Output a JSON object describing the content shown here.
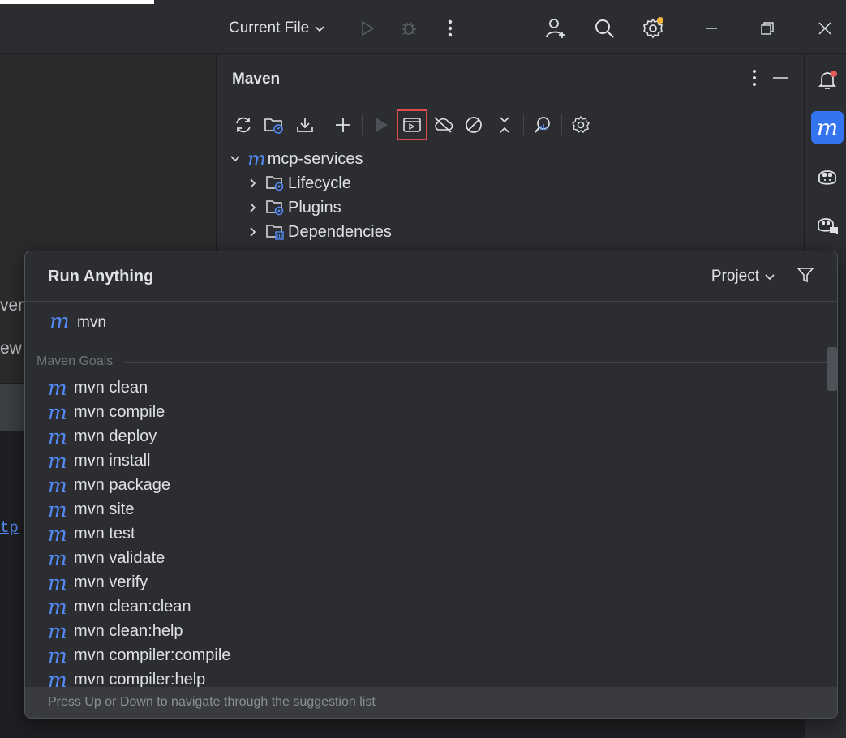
{
  "toolbar": {
    "run_config": "Current File",
    "icons": [
      "run-icon",
      "debug-icon",
      "more-vertical-icon",
      "add-user-icon",
      "search-icon",
      "settings-icon",
      "minimize-icon",
      "restore-icon",
      "close-icon"
    ],
    "settings_badge_color": "#f0b43c"
  },
  "editor": {
    "fragment_1": "ver",
    "fragment_2": "ew",
    "link_fragment": "tp"
  },
  "maven": {
    "title": "Maven",
    "toolbar_icons": [
      "reload-icon",
      "reload-folder-icon",
      "download-icon",
      "add-icon",
      "run-icon",
      "execute-goal-icon",
      "offline-icon",
      "skip-tests-icon",
      "collapse-icon",
      "analyze-dependencies-icon",
      "settings-icon"
    ],
    "highlighted_tool": "execute-goal-icon",
    "tree": {
      "root": "mcp-services",
      "children": [
        "Lifecycle",
        "Plugins",
        "Dependencies"
      ]
    }
  },
  "right_strip": {
    "icons": [
      "notifications-icon",
      "maven-icon",
      "copilot-icon",
      "copilot-chat-icon"
    ],
    "active": "maven-icon",
    "maven_logo": "m"
  },
  "run_anything": {
    "title": "Run Anything",
    "scope": "Project",
    "input_value": "mvn",
    "group_label": "Maven Goals",
    "goals": [
      "mvn clean",
      "mvn compile",
      "mvn deploy",
      "mvn install",
      "mvn package",
      "mvn site",
      "mvn test",
      "mvn validate",
      "mvn verify",
      "mvn clean:clean",
      "mvn clean:help",
      "mvn compiler:compile",
      "mvn compiler:help"
    ],
    "footer_hint": "Press Up or Down to navigate through the suggestion list"
  },
  "colors": {
    "accent": "#3574f0",
    "maven_blue": "#548af7",
    "highlight_red": "#e04b4b",
    "notification_red": "#e55b5b"
  }
}
